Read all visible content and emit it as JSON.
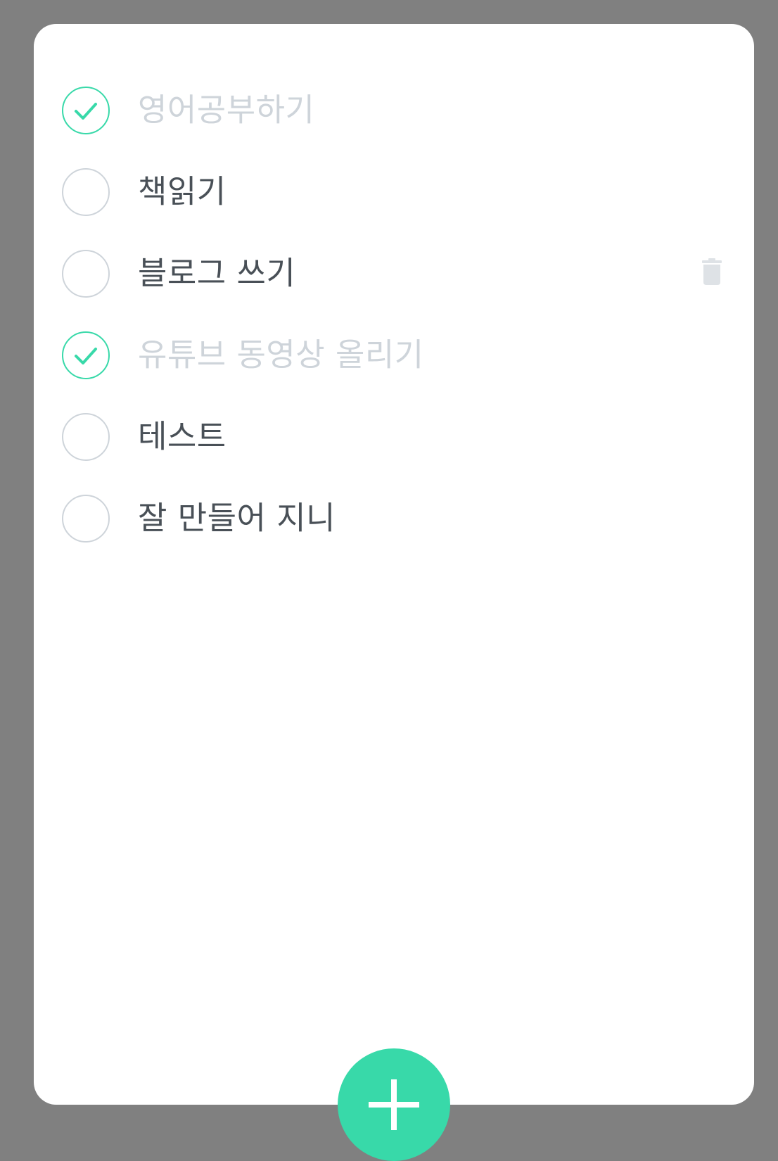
{
  "todos": [
    {
      "text": "영어공부하기",
      "done": true
    },
    {
      "text": "책읽기",
      "done": false
    },
    {
      "text": "블로그 쓰기",
      "done": false,
      "hovered": true
    },
    {
      "text": "유튜브 동영상 올리기",
      "done": true
    },
    {
      "text": "테스트",
      "done": false
    },
    {
      "text": "잘 만들어 지니",
      "done": false
    }
  ],
  "icons": {
    "check": "check-icon",
    "delete": "trash-icon",
    "add": "plus-icon"
  },
  "colors": {
    "background": "#808080",
    "card": "#ffffff",
    "accent": "#38d9a9",
    "text": "#495057",
    "done_text": "#ced4da",
    "circle_border": "#ced4da",
    "trash": "#dee2e6"
  }
}
